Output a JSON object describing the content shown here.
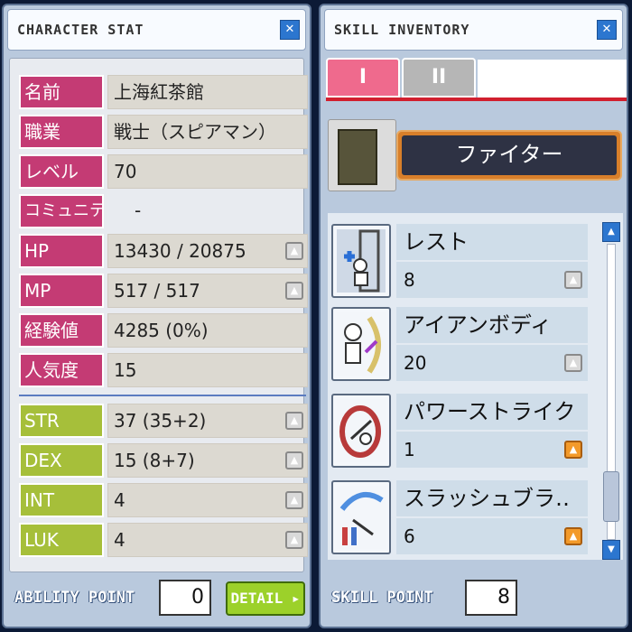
{
  "stat_window": {
    "title": "CHARACTER STAT",
    "rows": [
      {
        "label": "名前",
        "value": "上海紅茶館"
      },
      {
        "label": "職業",
        "value": "戦士（スピアマン）"
      },
      {
        "label": "レベル",
        "value": "70"
      },
      {
        "label": "コミュニティ",
        "value": "-"
      },
      {
        "label": "HP",
        "value": "13430 / 20875"
      },
      {
        "label": "MP",
        "value": "517 / 517"
      },
      {
        "label": "経験値",
        "value": "4285 (0%)"
      },
      {
        "label": "人気度",
        "value": "15"
      }
    ],
    "ability_rows": [
      {
        "label": "STR",
        "value": "37 (35+2)"
      },
      {
        "label": "DEX",
        "value": "15 (8+7)"
      },
      {
        "label": "INT",
        "value": "4"
      },
      {
        "label": "LUK",
        "value": "4"
      }
    ],
    "ability_point_label": "ABILITY POINT",
    "ability_point_value": "0",
    "detail_label": "DETAIL ▸"
  },
  "skill_window": {
    "title": "SKILL INVENTORY",
    "tabs": [
      "I",
      "II"
    ],
    "job_name": "ファイター",
    "skills": [
      {
        "name": "レスト",
        "level": "8",
        "upgrade": "gray"
      },
      {
        "name": "アイアンボディ",
        "level": "20",
        "upgrade": "gray"
      },
      {
        "name": "パワーストライク",
        "level": "1",
        "upgrade": "orange"
      },
      {
        "name": "スラッシュブラ‥",
        "level": "6",
        "upgrade": "orange"
      }
    ],
    "skill_point_label": "SKILL POINT",
    "skill_point_value": "8"
  },
  "colors": {
    "stat_label_pink": "#c43b74",
    "ability_label_green": "#a6bf3a",
    "tab_active": "#ef6a8d",
    "upgrade_orange": "#f39a2a"
  }
}
